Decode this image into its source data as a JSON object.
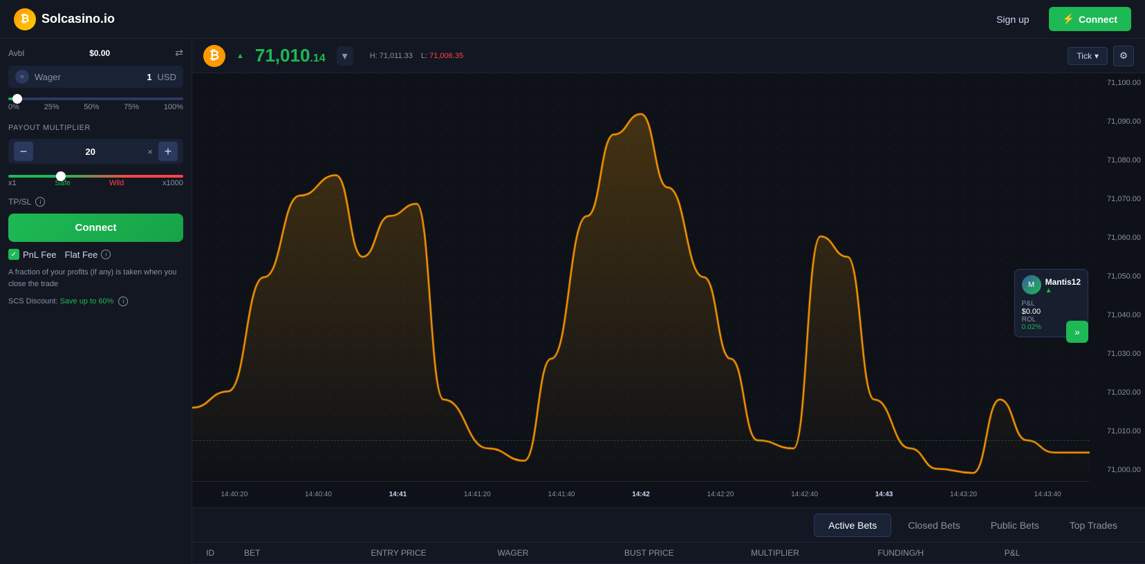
{
  "header": {
    "logo_text": "Solcasino.io",
    "signup_label": "Sign up",
    "connect_label": "Connect",
    "connect_icon": "⚡"
  },
  "left_panel": {
    "avbl_label": "Avbl",
    "avbl_value": "$0.00",
    "wager_label": "Wager",
    "wager_amount": "1",
    "wager_currency": "USD",
    "slider_marks": [
      "0%",
      "25%",
      "50%",
      "75%",
      "100%"
    ],
    "payout_multiplier_label": "PAYOUT MULTIPLIER",
    "mult_minus": "−",
    "mult_value": "20",
    "mult_x": "×",
    "mult_plus": "+",
    "safe_label": "Safe",
    "x1_label": "x1",
    "wild_label": "Wild",
    "x1000_label": "x1000",
    "tpsl_label": "TP/SL",
    "connect_btn_label": "Connect",
    "pnl_fee_label": "PnL Fee",
    "flat_fee_label": "Flat Fee",
    "pnl_desc": "A fraction of your profits (if any) is taken when you close the trade",
    "scs_label": "SCS Discount:",
    "scs_value": "Save up to 60%"
  },
  "chart_header": {
    "price_main": "71,010",
    "price_decimal": ".14",
    "price_up_arrow": "▲",
    "high_label": "H:",
    "high_value": "71,011.33",
    "low_label": "L:",
    "low_value": "71,006.35",
    "tick_label": "Tick",
    "dropdown_arrow": "▾"
  },
  "chart": {
    "y_labels": [
      "71,100.00",
      "71,090.00",
      "71,080.00",
      "71,070.00",
      "71,060.00",
      "71,050.00",
      "71,040.00",
      "71,030.00",
      "71,020.00",
      "71,010.00",
      "71,000.00"
    ],
    "x_labels": [
      "14:40:20",
      "14:40:40",
      "14:41",
      "14:41:20",
      "14:41:40",
      "14:42",
      "14:42:20",
      "14:42:40",
      "14:43",
      "14:43:20",
      "14:43:40"
    ]
  },
  "user_card": {
    "username": "Mantis12",
    "up_arrow": "▲",
    "pnl_label": "P&L",
    "pnl_value": "$0.00",
    "rol_label": "ROL",
    "rol_value": "0.02%"
  },
  "bottom_tabs": {
    "active_bets": "Active Bets",
    "closed_bets": "Closed Bets",
    "public_bets": "Public Bets",
    "top_trades": "Top Trades"
  },
  "table_headers": {
    "id": "ID",
    "bet": "BET",
    "entry_price": "ENTRY PRICE",
    "wager": "WAGER",
    "bust_price": "BUST PRICE",
    "multiplier": "MULTIPLIER",
    "funding_h": "FUNDING/H",
    "pnl": "P&L"
  }
}
